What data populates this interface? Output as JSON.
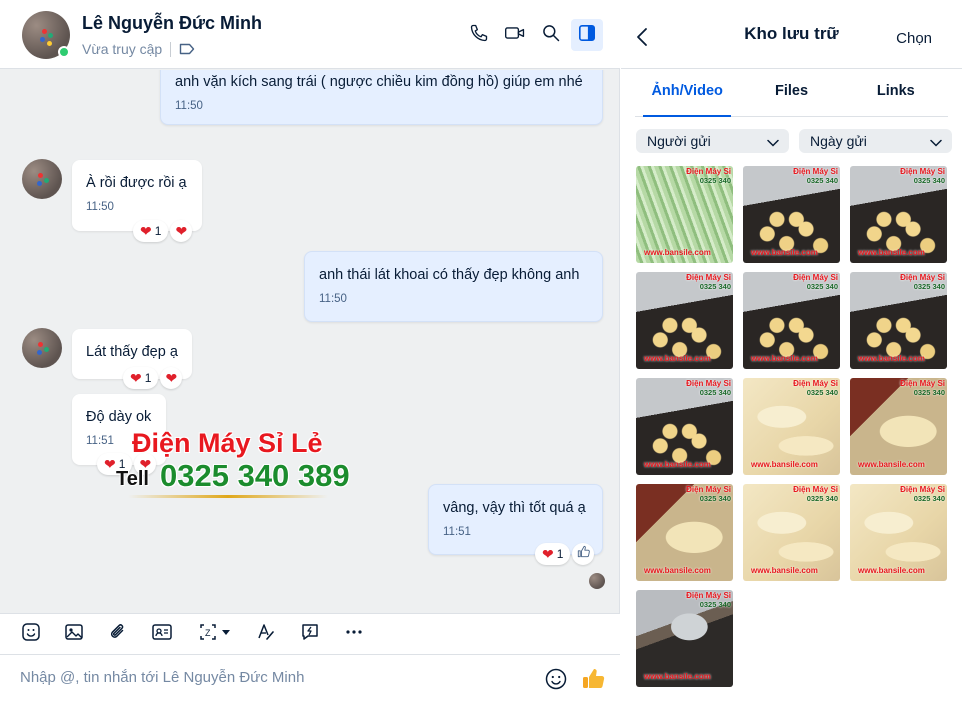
{
  "chat": {
    "contact_name": "Lê Nguyễn Đức Minh",
    "status": "Vừa truy cập",
    "messages": [
      {
        "text": "anh vặn kích sang trái ( ngược chiều kim đồng hồ) giúp em nhé",
        "time": "11:50"
      },
      {
        "text": "À rồi được rồi ạ",
        "time": "11:50",
        "reaction_count": "1"
      },
      {
        "text": "anh thái lát khoai có thấy đẹp không anh",
        "time": "11:50"
      },
      {
        "text": "Lát thấy đẹp ạ",
        "reaction_count": "1"
      },
      {
        "text": "Độ dày ok",
        "time": "11:51",
        "reaction_count": "1"
      },
      {
        "text": "vâng, vậy thì tốt quá ạ",
        "time": "11:51",
        "reaction_count": "1"
      }
    ],
    "watermark": {
      "brand": "Điện Máy Sỉ Lẻ",
      "tell_label": "Tell",
      "phone": "0325 340 389"
    },
    "composer_placeholder": "Nhập @, tin nhắn tới Lê Nguyễn Đức Minh"
  },
  "storage": {
    "title": "Kho lưu trữ",
    "select_label": "Chọn",
    "tabs": [
      "Ảnh/Video",
      "Files",
      "Links"
    ],
    "filters": [
      "Người gửi",
      "Ngày gửi"
    ],
    "thumb_watermark": {
      "brand": "Điện Máy Sỉ",
      "phone": "0325 340",
      "site": "www.bansile.com"
    }
  },
  "colors": {
    "accent": "#005ae0",
    "online": "#2ecc71",
    "heart": "#e0202b",
    "watermark_red": "#e8181f",
    "watermark_green": "#1b8c2d"
  },
  "icons": [
    "phone-icon",
    "video-icon",
    "search-icon",
    "panel-icon",
    "tag-icon",
    "back-icon",
    "sticker-icon",
    "image-icon",
    "attach-icon",
    "contact-card-icon",
    "screenshot-icon",
    "format-icon",
    "quick-message-icon",
    "more-icon",
    "emoji-icon",
    "like-icon",
    "heart-icon"
  ]
}
